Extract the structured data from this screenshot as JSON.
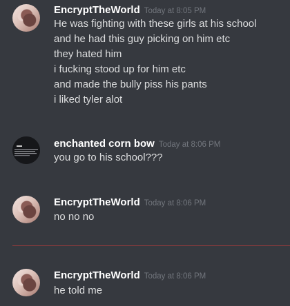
{
  "messages": [
    {
      "author": "EncryptTheWorld",
      "timestamp": "Today at 8:05 PM",
      "avatar": "profile-photo",
      "lines": [
        "He was fighting with these girls at his school",
        "and he had this guy picking on him etc",
        "they hated him",
        "i fucking stood up for him etc",
        "and made the bully piss his pants",
        "i liked tyler alot"
      ]
    },
    {
      "author": "enchanted corn bow",
      "timestamp": "Today at 8:06 PM",
      "avatar": "dark-screenshot-avatar",
      "lines": [
        "you go to his school???"
      ]
    },
    {
      "author": "EncryptTheWorld",
      "timestamp": "Today at 8:06 PM",
      "avatar": "profile-photo",
      "lines": [
        "no no no"
      ]
    },
    {
      "author": "EncryptTheWorld",
      "timestamp": "Today at 8:06 PM",
      "avatar": "profile-photo",
      "lines": [
        "he told me"
      ]
    }
  ],
  "colors": {
    "background": "#36393f",
    "username": "#ffffff",
    "timestamp": "#72767d",
    "message_text": "#dcddde",
    "new_messages_divider": "#8b3a3c"
  }
}
